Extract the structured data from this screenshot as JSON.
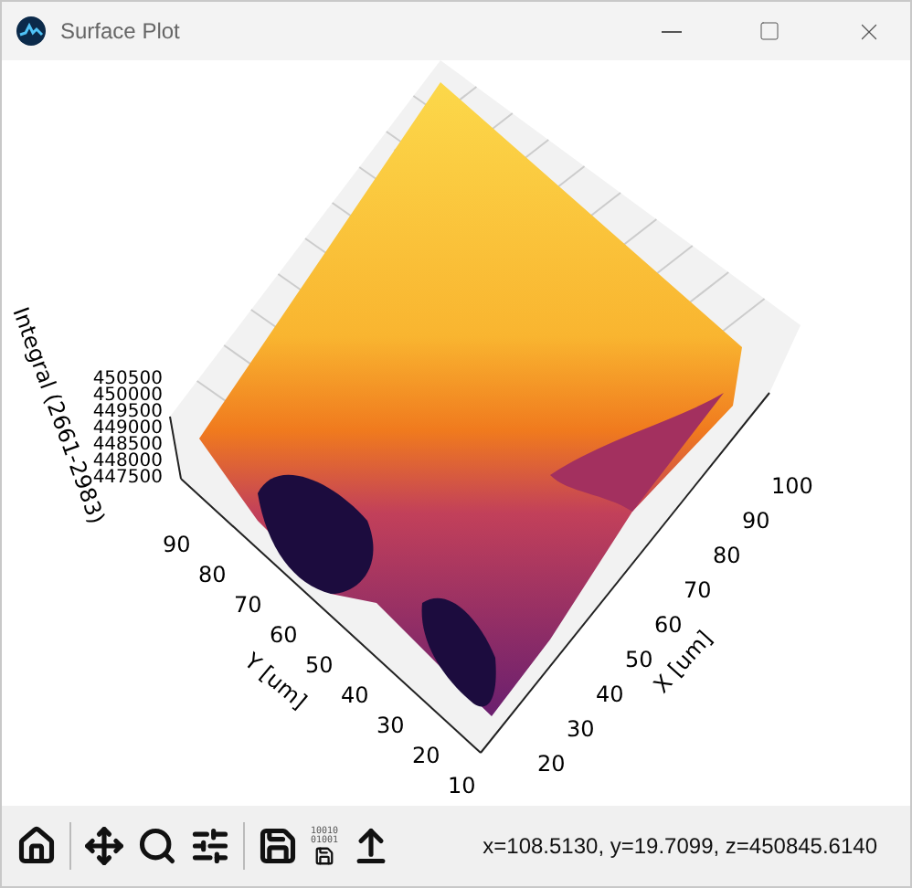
{
  "window": {
    "title": "Surface Plot"
  },
  "plot": {
    "z_axis": {
      "label": "Integral (2661-2983)",
      "ticks": [
        "450500",
        "450000",
        "449500",
        "449000",
        "448500",
        "448000",
        "447500"
      ]
    },
    "y_axis": {
      "label": "Y [um]",
      "ticks": [
        "90",
        "80",
        "70",
        "60",
        "50",
        "40",
        "30",
        "20",
        "10"
      ]
    },
    "x_axis": {
      "label": "X [um]",
      "ticks": [
        "100",
        "90",
        "80",
        "70",
        "60",
        "50",
        "40",
        "30",
        "20"
      ]
    }
  },
  "toolbar": {
    "buttons": [
      {
        "kind": "home"
      },
      {
        "kind": "pan"
      },
      {
        "kind": "zoom"
      },
      {
        "kind": "configure"
      },
      {
        "kind": "save"
      },
      {
        "kind": "save-data",
        "bits": [
          "10010",
          "01001"
        ]
      },
      {
        "kind": "export"
      }
    ]
  },
  "status": "x=108.5130, y=19.7099, z=450845.6140"
}
